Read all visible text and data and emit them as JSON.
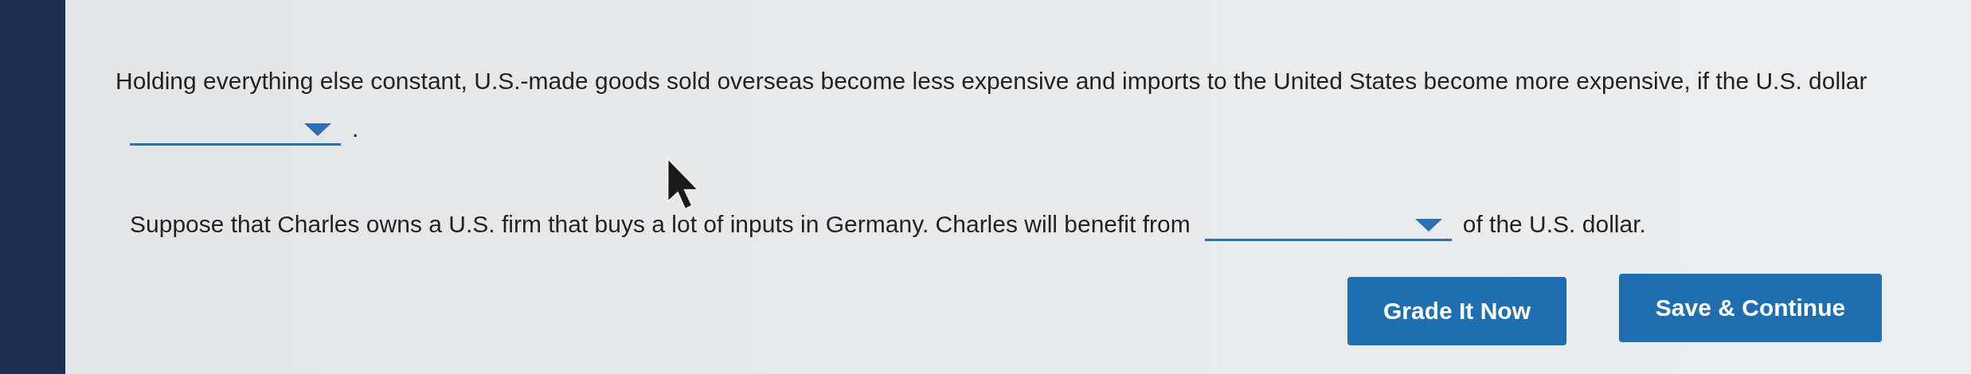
{
  "questions": [
    {
      "segments": [
        {
          "kind": "text",
          "text": "Holding everything else constant, U.S.-made goods sold overseas become less expensive and imports to the United States become more expensive, if the U.S. dollar"
        },
        {
          "kind": "dropdown"
        },
        {
          "kind": "text",
          "text": "."
        }
      ]
    },
    {
      "segments": [
        {
          "kind": "text",
          "text": "Suppose that Charles owns a U.S. firm that buys a lot of inputs in Germany. Charles will benefit from"
        },
        {
          "kind": "dropdown"
        },
        {
          "kind": "text",
          "text": "of the U.S. dollar."
        }
      ]
    }
  ],
  "buttons": [
    "Grade It Now",
    "Save & Continue"
  ]
}
